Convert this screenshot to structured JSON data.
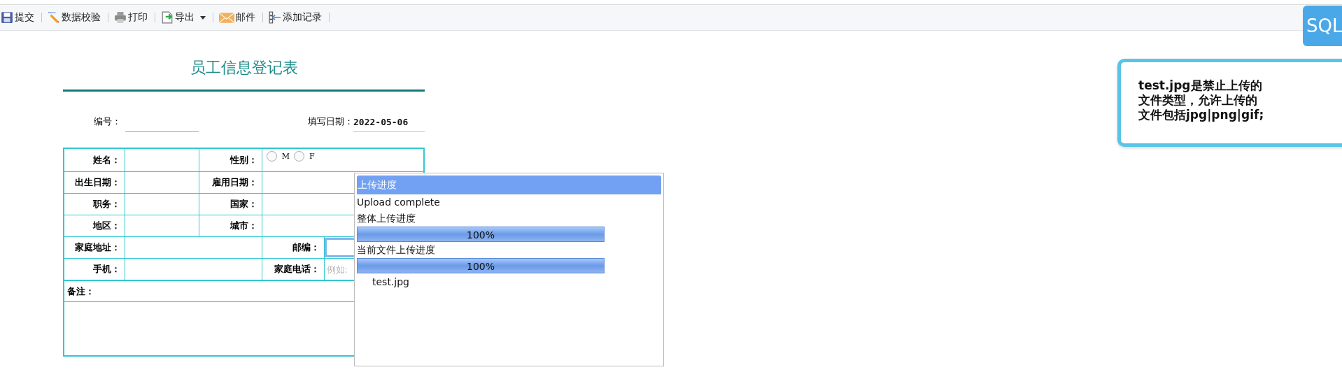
{
  "toolbar": {
    "items": [
      {
        "kind": "save",
        "label": "提交",
        "has_menu": false
      },
      {
        "kind": "validate",
        "label": "数据校验",
        "has_menu": false
      },
      {
        "kind": "print",
        "label": "打印",
        "has_menu": false
      },
      {
        "kind": "export",
        "label": "导出",
        "has_menu": true
      },
      {
        "kind": "mail",
        "label": "邮件",
        "has_menu": false
      },
      {
        "kind": "add-record",
        "label": "添加记录",
        "has_menu": false
      }
    ]
  },
  "sql_badge": {
    "label": "SQL"
  },
  "form": {
    "title": "员工信息登记表",
    "number_label": "编号：",
    "date_label": "填写日期：",
    "date_value": "2022-05-06",
    "rows": [
      {
        "kind": "pair",
        "cells": [
          {
            "kind": "label",
            "text": "姓名："
          },
          {
            "kind": "input"
          },
          {
            "kind": "label",
            "text": "性别："
          },
          {
            "kind": "radio-group",
            "options": [
              {
                "label": "M",
                "selected": false
              },
              {
                "label": "F",
                "selected": false
              }
            ]
          }
        ]
      },
      {
        "kind": "pair",
        "cells": [
          {
            "kind": "label",
            "text": "出生日期："
          },
          {
            "kind": "input"
          },
          {
            "kind": "label",
            "text": "雇用日期："
          },
          {
            "kind": "input"
          }
        ]
      },
      {
        "kind": "pair",
        "cells": [
          {
            "kind": "label",
            "text": "职务："
          },
          {
            "kind": "input"
          },
          {
            "kind": "label",
            "text": "国家："
          },
          {
            "kind": "input"
          }
        ]
      },
      {
        "kind": "pair",
        "cells": [
          {
            "kind": "label",
            "text": "地区："
          },
          {
            "kind": "input"
          },
          {
            "kind": "label",
            "text": "城市："
          },
          {
            "kind": "input"
          }
        ]
      },
      {
        "kind": "wide",
        "cells": [
          {
            "kind": "label",
            "text": "家庭地址："
          },
          {
            "kind": "input"
          },
          {
            "kind": "label",
            "text": "邮编："
          },
          {
            "kind": "input",
            "focused": true
          }
        ]
      },
      {
        "kind": "wide",
        "cells": [
          {
            "kind": "label",
            "text": "手机："
          },
          {
            "kind": "input"
          },
          {
            "kind": "label",
            "text": "家庭电话："
          },
          {
            "kind": "input",
            "placeholder": "例如:"
          }
        ]
      }
    ],
    "note": {
      "label": "备注："
    }
  },
  "upload_dialog": {
    "title": "上传进度",
    "status": "Upload complete",
    "overall_label": "整体上传进度",
    "overall": {
      "level": 1,
      "reading": "100%"
    },
    "current_label": "当前文件上传进度",
    "current": {
      "level": 1,
      "reading": "100%"
    },
    "files": [
      "test.jpg"
    ]
  },
  "tooltip": {
    "lines": [
      "test.jpg是禁止上传的",
      "文件类型，允许上传的",
      "文件包括jpg|png|gif;"
    ]
  }
}
